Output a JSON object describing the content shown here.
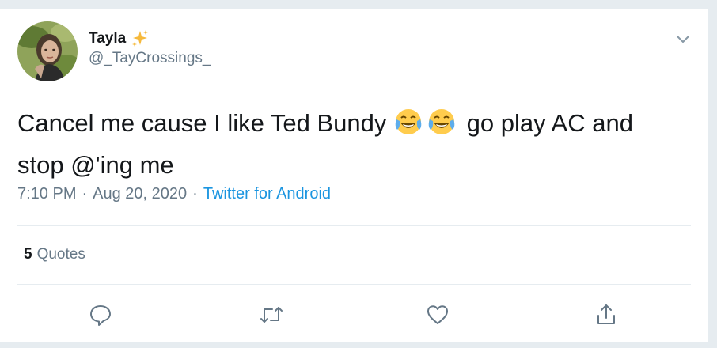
{
  "author": {
    "display_name": "Tayla",
    "display_name_emoji": "sparkles-icon",
    "handle": "@_TayCrossings_"
  },
  "tweet": {
    "text_before": "Cancel me cause I like Ted Bundy",
    "emojis": [
      "face-with-tears-of-joy-icon",
      "face-with-tears-of-joy-icon"
    ],
    "text_after": "go play AC and stop @'ing me"
  },
  "meta": {
    "time": "7:10 PM",
    "separator": "·",
    "date": "Aug 20, 2020",
    "source": "Twitter for Android"
  },
  "stats": {
    "quotes_count": "5",
    "quotes_label": "Quotes"
  },
  "actions": [
    "reply-icon",
    "retweet-icon",
    "like-icon",
    "share-icon"
  ],
  "colors": {
    "text": "#14171a",
    "secondary": "#657786",
    "link": "#1b95e0",
    "border": "#e6ecf0",
    "background": "#e6ecf0"
  }
}
